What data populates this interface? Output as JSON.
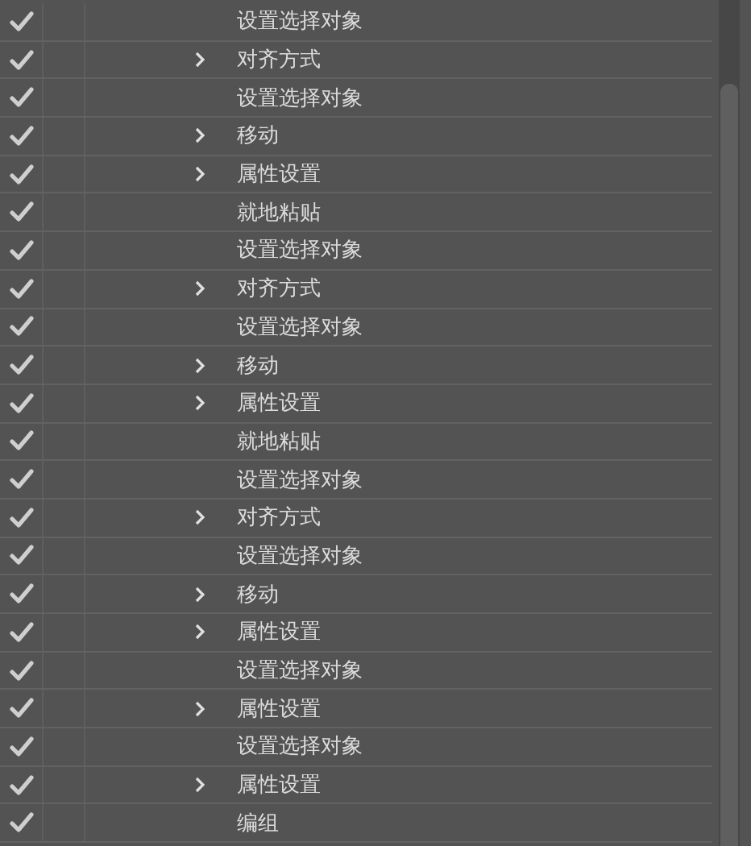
{
  "actions": [
    {
      "label": "设置选择对象",
      "kind": "item",
      "checked": true
    },
    {
      "label": "对齐方式",
      "kind": "group",
      "checked": true
    },
    {
      "label": "设置选择对象",
      "kind": "item",
      "checked": true
    },
    {
      "label": "移动",
      "kind": "group",
      "checked": true
    },
    {
      "label": "属性设置",
      "kind": "group",
      "checked": true
    },
    {
      "label": "就地粘贴",
      "kind": "item",
      "checked": true
    },
    {
      "label": "设置选择对象",
      "kind": "item",
      "checked": true
    },
    {
      "label": "对齐方式",
      "kind": "group",
      "checked": true
    },
    {
      "label": "设置选择对象",
      "kind": "item",
      "checked": true
    },
    {
      "label": "移动",
      "kind": "group",
      "checked": true
    },
    {
      "label": "属性设置",
      "kind": "group",
      "checked": true
    },
    {
      "label": "就地粘贴",
      "kind": "item",
      "checked": true
    },
    {
      "label": "设置选择对象",
      "kind": "item",
      "checked": true
    },
    {
      "label": "对齐方式",
      "kind": "group",
      "checked": true
    },
    {
      "label": "设置选择对象",
      "kind": "item",
      "checked": true
    },
    {
      "label": "移动",
      "kind": "group",
      "checked": true
    },
    {
      "label": "属性设置",
      "kind": "group",
      "checked": true
    },
    {
      "label": "设置选择对象",
      "kind": "item",
      "checked": true
    },
    {
      "label": "属性设置",
      "kind": "group",
      "checked": true
    },
    {
      "label": "设置选择对象",
      "kind": "item",
      "checked": true
    },
    {
      "label": "属性设置",
      "kind": "group",
      "checked": true
    },
    {
      "label": "编组",
      "kind": "item",
      "checked": true
    }
  ]
}
